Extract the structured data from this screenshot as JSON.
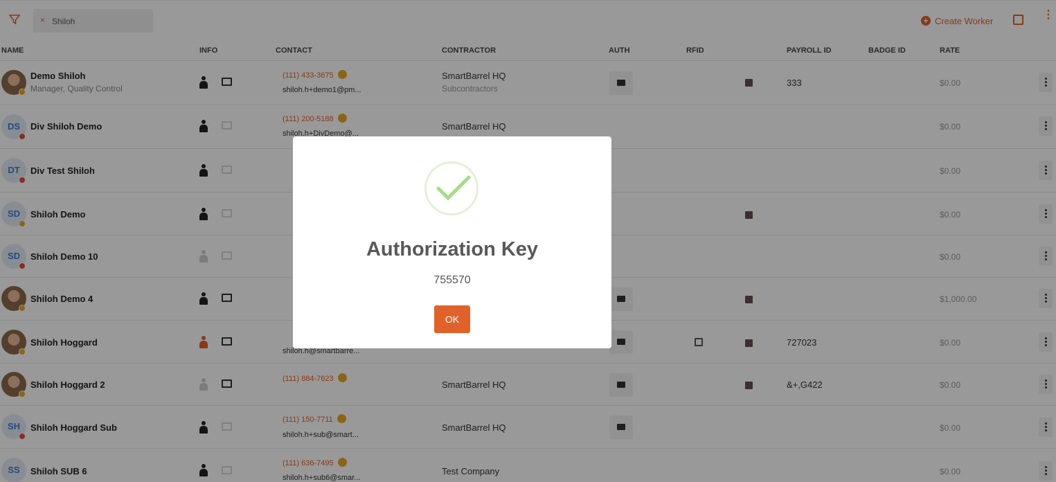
{
  "search": {
    "value": "Shiloh",
    "clear": "×"
  },
  "toolbar": {
    "create_label": "Create Worker",
    "plus": "+",
    "more": "⋮"
  },
  "columns": {
    "name": "NAME",
    "info": "INFO",
    "contact": "CONTACT",
    "contractor": "CONTRACTOR",
    "auth": "AUTH",
    "rfid": "RFID",
    "payroll": "PAYROLL ID",
    "badge": "BADGE ID",
    "rate": "RATE"
  },
  "rows": [
    {
      "name": "Demo Shiloh",
      "sub": "Manager, Quality Control",
      "phone": "(111) 433-3675",
      "email": "shiloh.h+demo1@pm...",
      "contractor": "SmartBarrel HQ",
      "contractor_sub": "Subcontractors",
      "payroll": "333",
      "rate": "$0.00",
      "initials": ""
    },
    {
      "name": "Div Shiloh Demo",
      "sub": "",
      "phone": "(111) 200-5188",
      "email": "shiloh.h+DivDemo@...",
      "contractor": "SmartBarrel HQ",
      "contractor_sub": "",
      "payroll": "",
      "rate": "$0.00",
      "initials": "DS"
    },
    {
      "name": "Div Test Shiloh",
      "sub": "",
      "phone": "",
      "email": "",
      "contractor": "",
      "contractor_sub": "",
      "payroll": "",
      "rate": "$0.00",
      "initials": "DT"
    },
    {
      "name": "Shiloh Demo",
      "sub": "",
      "phone": "",
      "email": "",
      "contractor": "",
      "contractor_sub": "",
      "payroll": "",
      "rate": "$0.00",
      "initials": "SD"
    },
    {
      "name": "Shiloh Demo 10",
      "sub": "",
      "phone": "",
      "email": "",
      "contractor": "",
      "contractor_sub": "",
      "payroll": "",
      "rate": "$0.00",
      "initials": "SD"
    },
    {
      "name": "Shiloh Demo 4",
      "sub": "",
      "phone": "",
      "email": "",
      "contractor": "",
      "contractor_sub": "",
      "payroll": "",
      "rate": "$1,000.00",
      "initials": ""
    },
    {
      "name": "Shiloh Hoggard",
      "sub": "",
      "phone": "",
      "email": "shiloh.h@smartbarre...",
      "contractor": "",
      "contractor_sub": "",
      "payroll": "727023",
      "rate": "$0.00",
      "initials": ""
    },
    {
      "name": "Shiloh Hoggard 2",
      "sub": "",
      "phone": "(111) 884-7623",
      "email": "",
      "contractor": "SmartBarrel HQ",
      "contractor_sub": "",
      "payroll": "&+,G422",
      "rate": "$0.00",
      "initials": ""
    },
    {
      "name": "Shiloh Hoggard Sub",
      "sub": "",
      "phone": "(111) 150-7711",
      "email": "shiloh.h+sub@smart...",
      "contractor": "SmartBarrel HQ",
      "contractor_sub": "",
      "payroll": "",
      "rate": "$0.00",
      "initials": "SH"
    },
    {
      "name": "Shiloh SUB 6",
      "sub": "",
      "phone": "(111) 636-7495",
      "email": "shiloh.h+sub6@smar...",
      "contractor": "Test Company",
      "contractor_sub": "",
      "payroll": "",
      "rate": "$0.00",
      "initials": "SS"
    }
  ],
  "modal": {
    "title": "Authorization Key",
    "key": "755570",
    "ok_label": "OK"
  },
  "colors": {
    "accent": "#e0622a",
    "success": "#8fcf5f",
    "overlay": "rgba(0,0,0,0.40)"
  }
}
